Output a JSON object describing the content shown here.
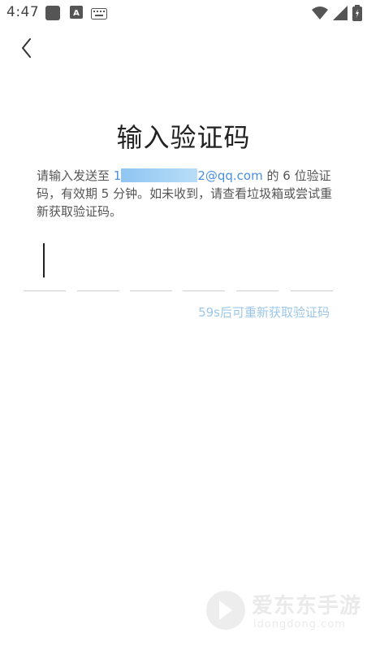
{
  "status_bar": {
    "time": "4:47",
    "icons": [
      "app-notification-icon",
      "text-a-icon",
      "keyboard-icon",
      "wifi-icon",
      "signal-icon",
      "battery-icon"
    ]
  },
  "header": {
    "back_icon": "chevron-left-icon"
  },
  "main": {
    "title": "输入验证码",
    "desc_prefix": "请输入发送至 ",
    "email_masked_fragment": "1",
    "email_visible": "2@qq.com",
    "desc_suffix": " 的 6 位验证码，有效期 5 分钟。如未收到，请查看垃圾箱或尝试重新获取验证码。",
    "code_digits": [
      "",
      "",
      "",
      "",
      "",
      ""
    ],
    "resend_text": "59s后可重新获取验证码"
  },
  "watermark": {
    "brand": "爱东东手游",
    "domain": "idongdong.com"
  },
  "colors": {
    "email_link": "#4a90e2",
    "resend_disabled": "#9cc7e8",
    "underline": "#cfcfcf"
  }
}
